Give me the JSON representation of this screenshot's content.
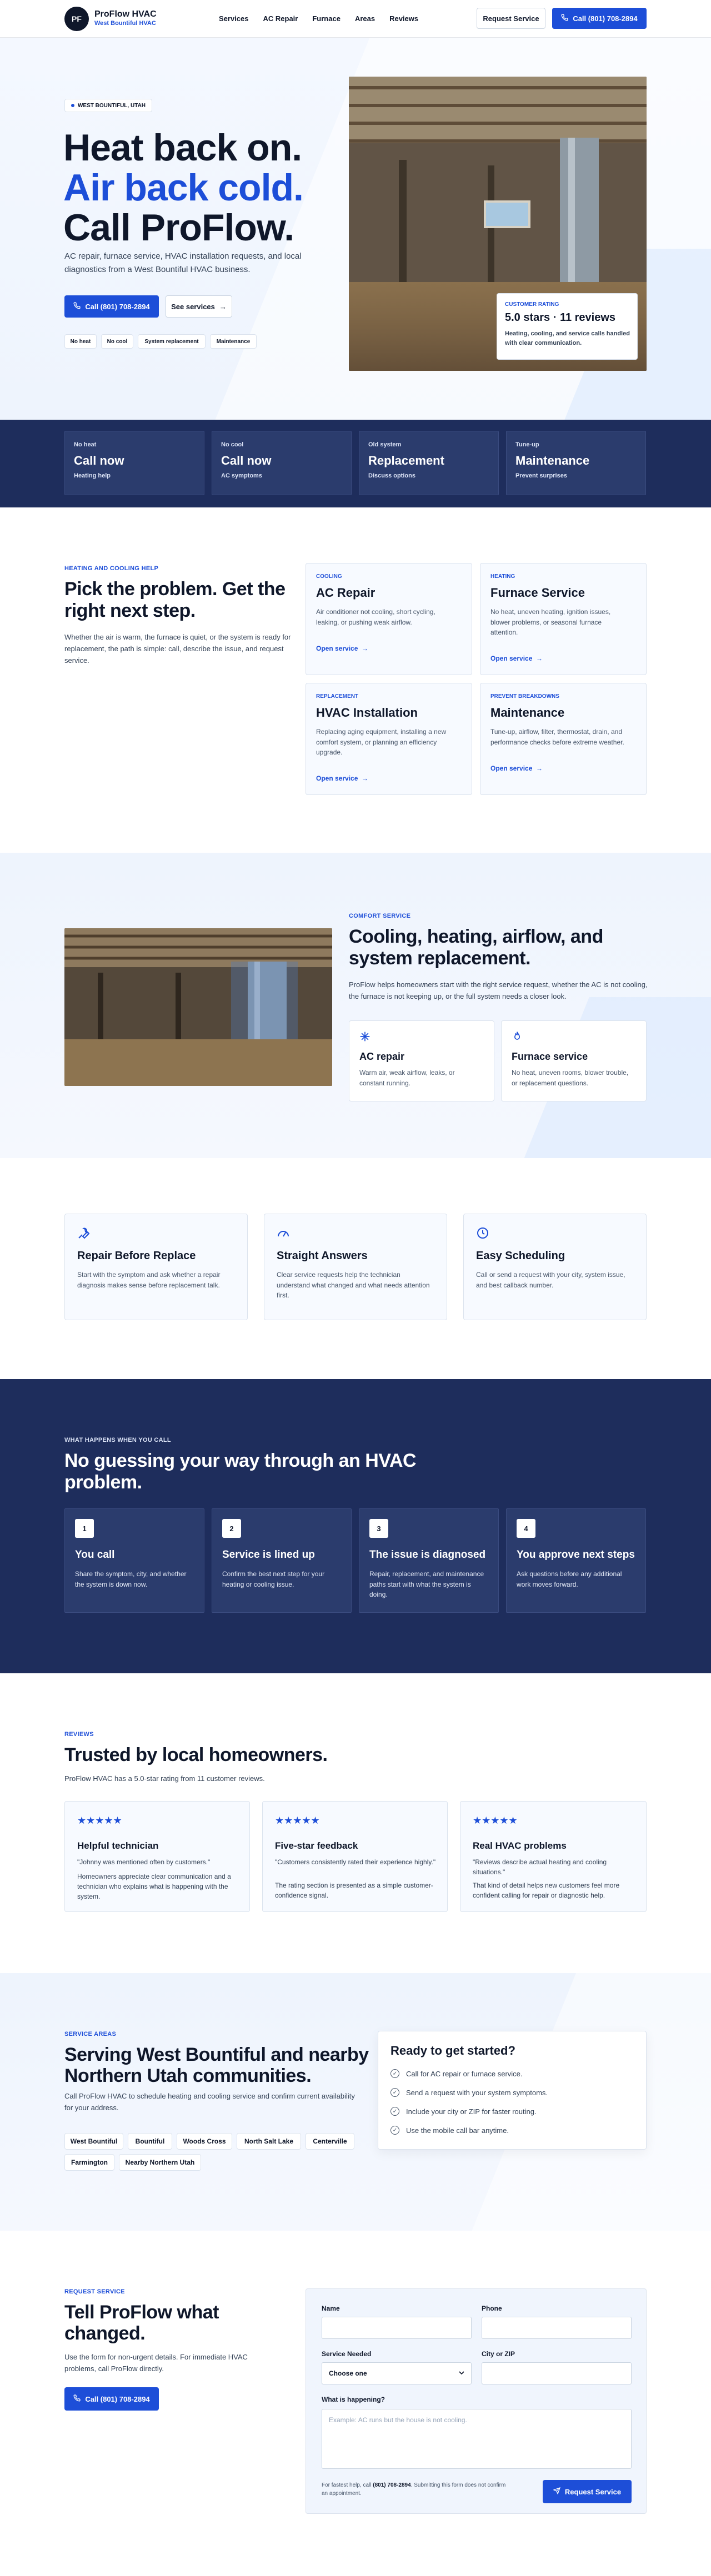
{
  "nav": {
    "logo_initials": "PF",
    "brand": "ProFlow HVAC",
    "brand_sub": "West Bountiful HVAC",
    "links": [
      "Services",
      "AC Repair",
      "Furnace",
      "Areas",
      "Reviews"
    ],
    "request_label": "Request Service",
    "call_label": "Call (801) 708-2894"
  },
  "hero": {
    "badge": "WEST BOUNTIFUL, UTAH",
    "line1": "Heat back on.",
    "line2": "Air back cold.",
    "line3": "Call ProFlow.",
    "lede": "AC repair, furnace service, HVAC installation requests, and local diagnostics from a West Bountiful HVAC business.",
    "call_label": "Call (801) 708-2894",
    "services_label": "See services",
    "tags": [
      "No heat",
      "No cool",
      "System replacement",
      "Maintenance"
    ],
    "rating_kicker": "CUSTOMER RATING",
    "rating_value": "5.0 stars · 11 reviews",
    "rating_text": "Heating, cooling, and service calls handled with clear communication."
  },
  "stats": [
    {
      "label": "No heat",
      "title": "Call now",
      "sub": "Heating help"
    },
    {
      "label": "No cool",
      "title": "Call now",
      "sub": "AC symptoms"
    },
    {
      "label": "Old system",
      "title": "Replacement",
      "sub": "Discuss options"
    },
    {
      "label": "Tune-up",
      "title": "Maintenance",
      "sub": "Prevent surprises"
    }
  ],
  "help": {
    "eyebrow": "HEATING AND COOLING HELP",
    "title": "Pick the problem. Get the right next step.",
    "text": "Whether the air is warm, the furnace is quiet, or the system is ready for replacement, the path is simple: call, describe the issue, and request service.",
    "services": [
      {
        "kicker": "COOLING",
        "title": "AC Repair",
        "text": "Air conditioner not cooling, short cycling, leaking, or pushing weak airflow.",
        "link": "Open service"
      },
      {
        "kicker": "HEATING",
        "title": "Furnace Service",
        "text": "No heat, uneven heating, ignition issues, blower problems, or seasonal furnace attention.",
        "link": "Open service"
      },
      {
        "kicker": "REPLACEMENT",
        "title": "HVAC Installation",
        "text": "Replacing aging equipment, installing a new comfort system, or planning an efficiency upgrade.",
        "link": "Open service"
      },
      {
        "kicker": "PREVENT BREAKDOWNS",
        "title": "Maintenance",
        "text": "Tune-up, airflow, filter, thermostat, drain, and performance checks before extreme weather.",
        "link": "Open service"
      }
    ]
  },
  "comfort": {
    "eyebrow": "COMFORT SERVICE",
    "title": "Cooling, heating, airflow, and system replacement.",
    "text": "ProFlow helps homeowners start with the right service request, whether the AC is not cooling, the furnace is not keeping up, or the full system needs a closer look.",
    "cards": [
      {
        "icon": "snowflake-icon",
        "title": "AC repair",
        "text": "Warm air, weak airflow, leaks, or constant running."
      },
      {
        "icon": "flame-icon",
        "title": "Furnace service",
        "text": "No heat, uneven rooms, blower trouble, or replacement questions."
      }
    ]
  },
  "values": [
    {
      "icon": "wrench-icon",
      "title": "Repair Before Replace",
      "text": "Start with the symptom and ask whether a repair diagnosis makes sense before replacement talk."
    },
    {
      "icon": "gauge-icon",
      "title": "Straight Answers",
      "text": "Clear service requests help the technician understand what changed and what needs attention first."
    },
    {
      "icon": "clock-icon",
      "title": "Easy Scheduling",
      "text": "Call or send a request with your city, system issue, and best callback number."
    }
  ],
  "process": {
    "eyebrow": "WHAT HAPPENS WHEN YOU CALL",
    "title": "No guessing your way through an HVAC problem.",
    "steps": [
      {
        "n": "1",
        "title": "You call",
        "text": "Share the symptom, city, and whether the system is down now."
      },
      {
        "n": "2",
        "title": "Service is lined up",
        "text": "Confirm the best next step for your heating or cooling issue."
      },
      {
        "n": "3",
        "title": "The issue is diagnosed",
        "text": "Repair, replacement, and maintenance paths start with what the system is doing."
      },
      {
        "n": "4",
        "title": "You approve next steps",
        "text": "Ask questions before any additional work moves forward."
      }
    ]
  },
  "reviews": {
    "eyebrow": "REVIEWS",
    "title": "Trusted by local homeowners.",
    "text": "ProFlow HVAC has a 5.0-star rating from 11 customer reviews.",
    "stars": "★★★★★",
    "items": [
      {
        "title": "Helpful technician",
        "quote": "\"Johnny was mentioned often by customers.\"",
        "text": "Homeowners appreciate clear communication and a technician who explains what is happening with the system."
      },
      {
        "title": "Five-star feedback",
        "quote": "\"Customers consistently rated their experience highly.\"",
        "text": "The rating section is presented as a simple customer-confidence signal."
      },
      {
        "title": "Real HVAC problems",
        "quote": "\"Reviews describe actual heating and cooling situations.\"",
        "text": "That kind of detail helps new customers feel more confident calling for repair or diagnostic help."
      }
    ]
  },
  "areas": {
    "eyebrow": "SERVICE AREAS",
    "title": "Serving West Bountiful and nearby Northern Utah communities.",
    "text": "Call ProFlow HVAC to schedule heating and cooling service and confirm current availability for your address.",
    "list": [
      "West Bountiful",
      "Bountiful",
      "Woods Cross",
      "North Salt Lake",
      "Centerville",
      "Farmington",
      "Nearby Northern Utah"
    ],
    "ready_title": "Ready to get started?",
    "checklist": [
      "Call for AC repair or furnace service.",
      "Send a request with your system symptoms.",
      "Include your city or ZIP for faster routing.",
      "Use the mobile call bar anytime."
    ]
  },
  "request": {
    "eyebrow": "REQUEST SERVICE",
    "title": "Tell ProFlow what changed.",
    "text": "Use the form for non-urgent details. For immediate HVAC problems, call ProFlow directly.",
    "call_label": "Call (801) 708-2894",
    "form": {
      "name_label": "Name",
      "phone_label": "Phone",
      "service_label": "Service Needed",
      "service_value": "Choose one",
      "city_label": "City or ZIP",
      "what_label": "What is happening?",
      "what_placeholder": "Example: AC runs but the house is not cooling.",
      "note_pre": "For fastest help, call",
      "note_phone": "(801) 708-2894",
      "note_post": ". Submitting this form does not confirm an appointment.",
      "submit_label": "Request Service"
    }
  }
}
